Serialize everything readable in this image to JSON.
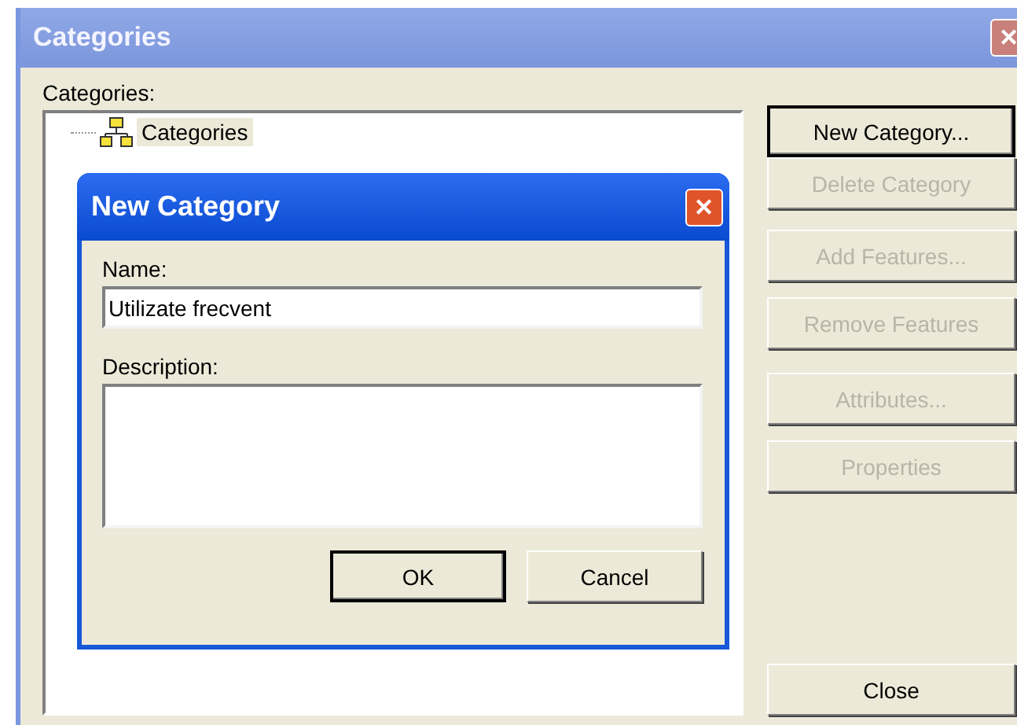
{
  "window": {
    "title": "Categories",
    "close": "✕"
  },
  "tree_label": "Categories:",
  "tree": [
    {
      "label": "Categories",
      "selected": true
    }
  ],
  "button_groups": [
    [
      {
        "label": "New Category...",
        "disabled": false,
        "default": true
      }
    ],
    [
      {
        "label": "Delete Category",
        "disabled": true,
        "default": false
      }
    ],
    [
      {
        "label": "Add Features...",
        "disabled": true,
        "default": false
      },
      {
        "label": "Remove Features",
        "disabled": true,
        "default": false
      }
    ],
    [
      {
        "label": "Attributes...",
        "disabled": true,
        "default": false
      },
      {
        "label": "Properties",
        "disabled": true,
        "default": false
      }
    ]
  ],
  "close_button": {
    "label": "Close",
    "disabled": false,
    "default": false
  },
  "dialog": {
    "title": "New Category",
    "close": "✕",
    "name_label": "Name:",
    "name_value": "Utilizate frecvent",
    "description_label": "Description:",
    "buttons": [
      {
        "label": "OK",
        "default": true
      },
      {
        "label": "Cancel",
        "default": false
      }
    ]
  }
}
